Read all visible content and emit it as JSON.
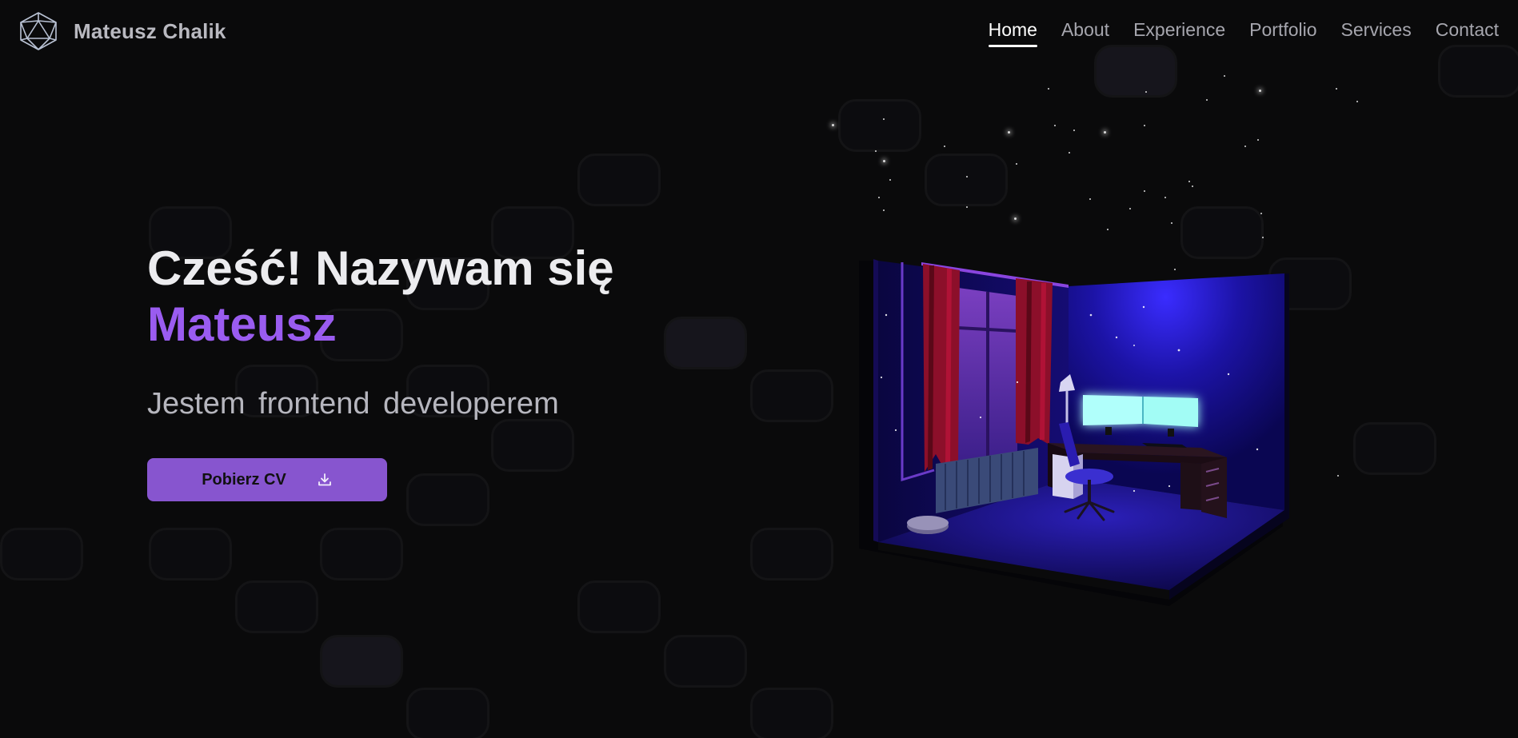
{
  "brand": {
    "name": "Mateusz Chalik",
    "logo_icon": "icosahedron-logo-icon"
  },
  "nav": {
    "items": [
      {
        "label": "Home",
        "active": true
      },
      {
        "label": "About",
        "active": false
      },
      {
        "label": "Experience",
        "active": false
      },
      {
        "label": "Portfolio",
        "active": false
      },
      {
        "label": "Services",
        "active": false
      },
      {
        "label": "Contact",
        "active": false
      }
    ]
  },
  "hero": {
    "greeting": "Cześć! Nazywam się",
    "name": "Mateusz",
    "subtitle": "Jestem frontend developerem",
    "cv_button": {
      "label": "Pobierz CV",
      "icon": "download-icon"
    }
  },
  "colors": {
    "background": "#0a0a0b",
    "accent": "#9a5cf0",
    "button": "#8755cf",
    "room_glow": "#2a1ec8",
    "monitor": "#a8fffa"
  }
}
